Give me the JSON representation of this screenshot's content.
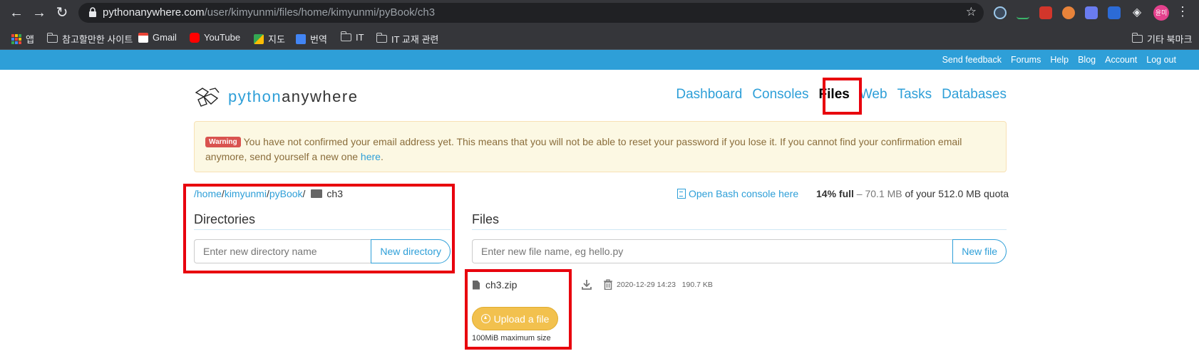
{
  "browser": {
    "url_host": "pythonanywhere.com",
    "url_path": "/user/kimyunmi/files/home/kimyunmi/pyBook/ch3",
    "profile_label": "윤미",
    "bookmarks": [
      {
        "label": "앱",
        "icon": "apps-grid-icon"
      },
      {
        "label": "참고할만한 사이트",
        "icon": "folder-icon"
      },
      {
        "label": "Gmail",
        "icon": "gmail-icon"
      },
      {
        "label": "YouTube",
        "icon": "youtube-icon"
      },
      {
        "label": "지도",
        "icon": "maps-icon"
      },
      {
        "label": "번역",
        "icon": "translate-icon"
      },
      {
        "label": "IT",
        "icon": "folder-icon"
      },
      {
        "label": "IT 교재 관련",
        "icon": "folder-icon"
      }
    ],
    "other_bookmarks": "기타 북마크"
  },
  "topbar": {
    "links": [
      "Send feedback",
      "Forums",
      "Help",
      "Blog",
      "Account",
      "Log out"
    ]
  },
  "logo": {
    "part1": "python",
    "part2": "anywhere"
  },
  "mainnav": {
    "items": [
      "Dashboard",
      "Consoles",
      "Files",
      "Web",
      "Tasks",
      "Databases"
    ],
    "active": "Files"
  },
  "warning": {
    "badge": "Warning",
    "text": "You have not confirmed your email address yet. This means that you will not be able to reset your password if you lose it. If you cannot find your confirmation email anymore, send yourself a new one ",
    "link": "here",
    "end": "."
  },
  "breadcrumb": {
    "parts": [
      "/home",
      "/",
      "kimyunmi",
      "/",
      "pyBook",
      "/"
    ],
    "current": "ch3"
  },
  "bash_link": "Open Bash console here",
  "quota": {
    "percent": "14% full",
    "dash": " – ",
    "used": "70.1 MB",
    "rest": " of your 512.0 MB quota"
  },
  "directories": {
    "title": "Directories",
    "placeholder": "Enter new directory name",
    "button": "New directory"
  },
  "files": {
    "title": "Files",
    "placeholder": "Enter new file name, eg hello.py",
    "button": "New file",
    "items": [
      {
        "name": "ch3.zip",
        "date": "2020-12-29 14:23",
        "size": "190.7 KB"
      }
    ],
    "upload_button": "Upload a file",
    "max_size": "100MiB maximum size"
  },
  "colors": {
    "accent": "#2e9fd8",
    "highlight": "#e8000d",
    "upload": "#f2c14e"
  }
}
